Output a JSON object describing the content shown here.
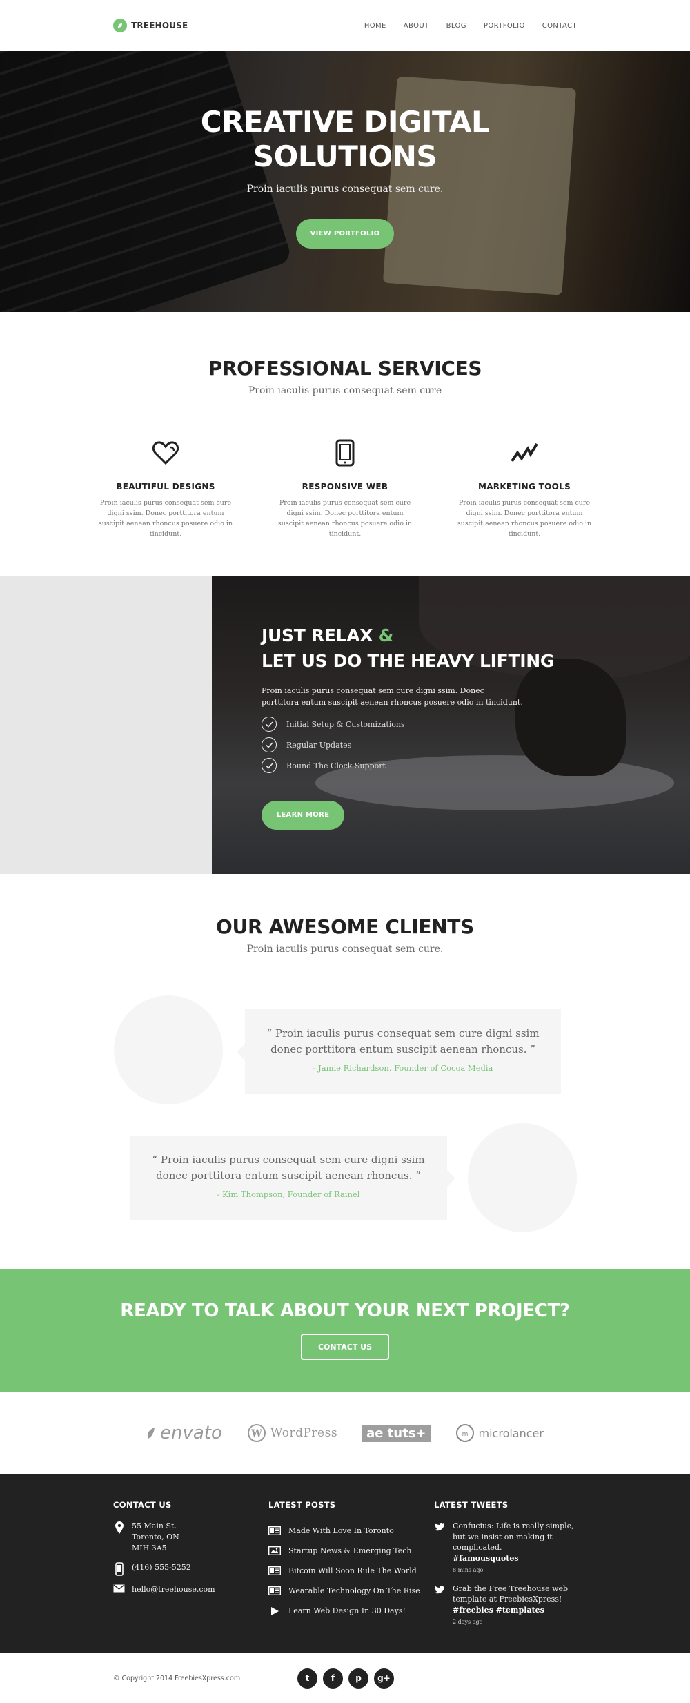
{
  "header": {
    "logo_text": "TREEHOUSE",
    "nav": [
      "HOME",
      "ABOUT",
      "BLOG",
      "PORTFOLIO",
      "CONTACT"
    ]
  },
  "hero": {
    "title_line1": "CREATIVE DIGITAL",
    "title_line2": "SOLUTIONS",
    "subtitle": "Proin iaculis purus consequat sem cure.",
    "button": "VIEW PORTFOLIO"
  },
  "services": {
    "title": "PROFESSIONAL SERVICES",
    "subtitle": "Proin iaculis purus consequat sem cure",
    "items": [
      {
        "icon": "heart-icon",
        "title": "BEAUTIFUL DESIGNS",
        "text": "Proin iaculis purus consequat sem cure digni ssim. Donec porttitora entum suscipit aenean rhoncus posuere odio in tincidunt."
      },
      {
        "icon": "mobile-icon",
        "title": "RESPONSIVE WEB",
        "text": "Proin iaculis purus consequat sem cure digni ssim. Donec porttitora entum suscipit aenean rhoncus posuere odio in tincidunt."
      },
      {
        "icon": "chart-icon",
        "title": "MARKETING TOOLS",
        "text": "Proin iaculis purus consequat sem cure digni ssim. Donec porttitora entum suscipit aenean rhoncus posuere odio in tincidunt."
      }
    ]
  },
  "relax": {
    "title_line1": "JUST RELAX",
    "amp": "&",
    "title_line2": "LET US DO THE HEAVY LIFTING",
    "description": "Proin iaculis purus consequat sem cure  digni ssim. Donec porttitora entum suscipit  aenean rhoncus posuere odio in tincidunt.",
    "features": [
      "Initial Setup & Customizations",
      "Regular Updates",
      "Round The Clock Support"
    ],
    "button": "LEARN MORE"
  },
  "clients": {
    "title": "OUR AWESOME CLIENTS",
    "subtitle": "Proin iaculis purus consequat sem cure.",
    "testimonials": [
      {
        "text": "“ Proin iaculis purus consequat sem cure  digni ssim donec porttitora entum suscipit aenean rhoncus. ”",
        "author": "- Jamie Richardson, Founder of Cocoa Media"
      },
      {
        "text": "“ Proin iaculis purus consequat sem cure  digni ssim donec porttitora entum suscipit aenean rhoncus. ”",
        "author": "- Kim Thompson, Founder of Rainel"
      }
    ]
  },
  "cta": {
    "title": "READY TO TALK ABOUT YOUR NEXT PROJECT?",
    "button": "CONTACT US"
  },
  "partners": [
    "envato",
    "WordPress",
    "ae tuts+",
    "microlancer"
  ],
  "footer": {
    "contact": {
      "title": "CONTACT US",
      "address": [
        "55 Main St.",
        "Toronto, ON",
        "MIH 3A5"
      ],
      "phone": "(416) 555-5252",
      "email": "hello@treehouse.com"
    },
    "posts": {
      "title": "LATEST POSTS",
      "items": [
        {
          "icon": "article-icon",
          "label": "Made With Love In Toronto"
        },
        {
          "icon": "image-icon",
          "label": "Startup News & Emerging Tech"
        },
        {
          "icon": "article-icon",
          "label": "Bitcoin Will Soon Rule The World"
        },
        {
          "icon": "article-icon",
          "label": "Wearable Technology On The Rise"
        },
        {
          "icon": "play-icon",
          "label": "Learn Web Design In 30 Days!"
        }
      ]
    },
    "tweets": {
      "title": "LATEST TWEETS",
      "items": [
        {
          "text": "Confucius: Life is really simple, but we insist on making it complicated.",
          "tags": "#famousquotes",
          "time": "8 mins ago"
        },
        {
          "text": "Grab the Free Treehouse web template at FreebiesXpress!",
          "tags": "#freebies #templates",
          "time": "2 days ago"
        }
      ]
    }
  },
  "bottom": {
    "copyright": "© Copyright 2014 FreebiesXpress.com",
    "socials": [
      {
        "icon": "twitter-icon",
        "glyph": "t"
      },
      {
        "icon": "facebook-icon",
        "glyph": "f"
      },
      {
        "icon": "pinterest-icon",
        "glyph": "p"
      },
      {
        "icon": "googleplus-icon",
        "glyph": "g+"
      }
    ]
  },
  "colors": {
    "accent": "#78c475",
    "dark": "#222222",
    "light_panel": "#f5f5f5"
  }
}
